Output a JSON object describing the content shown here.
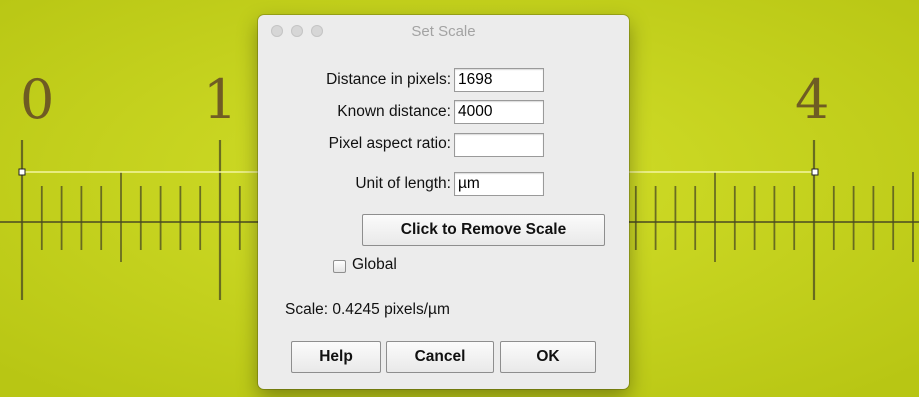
{
  "background": {
    "ruler_numbers": [
      "0",
      "1",
      "4"
    ]
  },
  "dialog": {
    "title": "Set Scale",
    "fields": {
      "distance_pixels": {
        "label": "Distance in pixels:",
        "value": "1698"
      },
      "known_distance": {
        "label": "Known distance:",
        "value": "4000"
      },
      "pixel_aspect_ratio": {
        "label": "Pixel aspect ratio:",
        "value": ""
      },
      "unit_of_length": {
        "label": "Unit of length:",
        "value": "µm"
      }
    },
    "remove_scale_button": "Click to Remove Scale",
    "global_checkbox": {
      "label": "Global",
      "checked": false
    },
    "scale_text": "Scale: 0.4245 pixels/µm",
    "buttons": {
      "help": "Help",
      "cancel": "Cancel",
      "ok": "OK"
    }
  },
  "colors": {
    "background": "#c5d31a",
    "dialog": "#ececec",
    "selection_line": "#f4f6a0"
  }
}
